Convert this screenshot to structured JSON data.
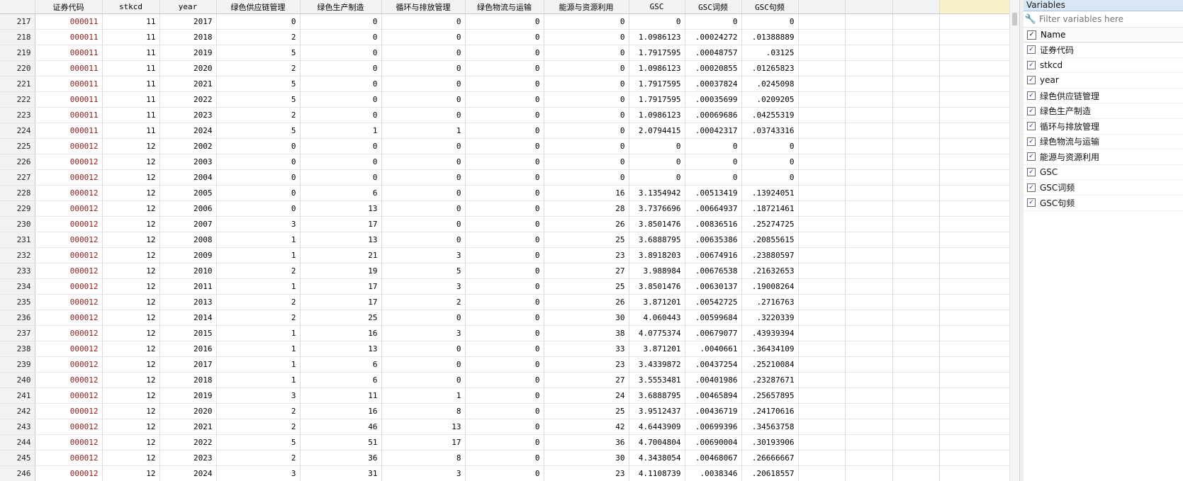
{
  "columns": [
    "证券代码",
    "stkcd",
    "year",
    "绿色供应链管理",
    "绿色生产制造",
    "循环与排放管理",
    "绿色物流与运输",
    "能源与资源利用",
    "GSC",
    "GSC词频",
    "GSC句频"
  ],
  "rows": [
    [
      "217",
      "000011",
      "11",
      "2017",
      "0",
      "0",
      "0",
      "0",
      "0",
      "0",
      "0",
      "0"
    ],
    [
      "218",
      "000011",
      "11",
      "2018",
      "2",
      "0",
      "0",
      "0",
      "0",
      "1.0986123",
      ".00024272",
      ".01388889"
    ],
    [
      "219",
      "000011",
      "11",
      "2019",
      "5",
      "0",
      "0",
      "0",
      "0",
      "1.7917595",
      ".00048757",
      ".03125"
    ],
    [
      "220",
      "000011",
      "11",
      "2020",
      "2",
      "0",
      "0",
      "0",
      "0",
      "1.0986123",
      ".00020855",
      ".01265823"
    ],
    [
      "221",
      "000011",
      "11",
      "2021",
      "5",
      "0",
      "0",
      "0",
      "0",
      "1.7917595",
      ".00037824",
      ".0245098"
    ],
    [
      "222",
      "000011",
      "11",
      "2022",
      "5",
      "0",
      "0",
      "0",
      "0",
      "1.7917595",
      ".00035699",
      ".0209205"
    ],
    [
      "223",
      "000011",
      "11",
      "2023",
      "2",
      "0",
      "0",
      "0",
      "0",
      "1.0986123",
      ".00069686",
      ".04255319"
    ],
    [
      "224",
      "000011",
      "11",
      "2024",
      "5",
      "1",
      "1",
      "0",
      "0",
      "2.0794415",
      ".00042317",
      ".03743316"
    ],
    [
      "225",
      "000012",
      "12",
      "2002",
      "0",
      "0",
      "0",
      "0",
      "0",
      "0",
      "0",
      "0"
    ],
    [
      "226",
      "000012",
      "12",
      "2003",
      "0",
      "0",
      "0",
      "0",
      "0",
      "0",
      "0",
      "0"
    ],
    [
      "227",
      "000012",
      "12",
      "2004",
      "0",
      "0",
      "0",
      "0",
      "0",
      "0",
      "0",
      "0"
    ],
    [
      "228",
      "000012",
      "12",
      "2005",
      "0",
      "6",
      "0",
      "0",
      "16",
      "3.1354942",
      ".00513419",
      ".13924051"
    ],
    [
      "229",
      "000012",
      "12",
      "2006",
      "0",
      "13",
      "0",
      "0",
      "28",
      "3.7376696",
      ".00664937",
      ".18721461"
    ],
    [
      "230",
      "000012",
      "12",
      "2007",
      "3",
      "17",
      "0",
      "0",
      "26",
      "3.8501476",
      ".00836516",
      ".25274725"
    ],
    [
      "231",
      "000012",
      "12",
      "2008",
      "1",
      "13",
      "0",
      "0",
      "25",
      "3.6888795",
      ".00635386",
      ".20855615"
    ],
    [
      "232",
      "000012",
      "12",
      "2009",
      "1",
      "21",
      "3",
      "0",
      "23",
      "3.8918203",
      ".00674916",
      ".23880597"
    ],
    [
      "233",
      "000012",
      "12",
      "2010",
      "2",
      "19",
      "5",
      "0",
      "27",
      "3.988984",
      ".00676538",
      ".21632653"
    ],
    [
      "234",
      "000012",
      "12",
      "2011",
      "1",
      "17",
      "3",
      "0",
      "25",
      "3.8501476",
      ".00630137",
      ".19008264"
    ],
    [
      "235",
      "000012",
      "12",
      "2013",
      "2",
      "17",
      "2",
      "0",
      "26",
      "3.871201",
      ".00542725",
      ".2716763"
    ],
    [
      "236",
      "000012",
      "12",
      "2014",
      "2",
      "25",
      "0",
      "0",
      "30",
      "4.060443",
      ".00599684",
      ".3220339"
    ],
    [
      "237",
      "000012",
      "12",
      "2015",
      "1",
      "16",
      "3",
      "0",
      "38",
      "4.0775374",
      ".00679077",
      ".43939394"
    ],
    [
      "238",
      "000012",
      "12",
      "2016",
      "1",
      "13",
      "0",
      "0",
      "33",
      "3.871201",
      ".0040661",
      ".36434109"
    ],
    [
      "239",
      "000012",
      "12",
      "2017",
      "1",
      "6",
      "0",
      "0",
      "23",
      "3.4339872",
      ".00437254",
      ".25210084"
    ],
    [
      "240",
      "000012",
      "12",
      "2018",
      "1",
      "6",
      "0",
      "0",
      "27",
      "3.5553481",
      ".00401986",
      ".23287671"
    ],
    [
      "241",
      "000012",
      "12",
      "2019",
      "3",
      "11",
      "1",
      "0",
      "24",
      "3.6888795",
      ".00465894",
      ".25657895"
    ],
    [
      "242",
      "000012",
      "12",
      "2020",
      "2",
      "16",
      "8",
      "0",
      "25",
      "3.9512437",
      ".00436719",
      ".24170616"
    ],
    [
      "243",
      "000012",
      "12",
      "2021",
      "2",
      "46",
      "13",
      "0",
      "42",
      "4.6443909",
      ".00699396",
      ".34563758"
    ],
    [
      "244",
      "000012",
      "12",
      "2022",
      "5",
      "51",
      "17",
      "0",
      "36",
      "4.7004804",
      ".00690004",
      ".30193906"
    ],
    [
      "245",
      "000012",
      "12",
      "2023",
      "2",
      "36",
      "8",
      "0",
      "30",
      "4.3438054",
      ".00468067",
      ".26666667"
    ],
    [
      "246",
      "000012",
      "12",
      "2024",
      "3",
      "31",
      "3",
      "0",
      "23",
      "4.1108739",
      ".0038346",
      ".20618557"
    ]
  ],
  "variables_panel": {
    "title": "Variables",
    "filter_placeholder": "Filter variables here",
    "name_header": "Name",
    "items": [
      "证券代码",
      "stkcd",
      "year",
      "绿色供应链管理",
      "绿色生产制造",
      "循环与排放管理",
      "绿色物流与运输",
      "能源与资源利用",
      "GSC",
      "GSC词频",
      "GSC句频"
    ]
  },
  "colors": {
    "code_text": "#8b1a1a",
    "panel_header": "#d9e6f4",
    "highlight_col": "#fbf1c8"
  }
}
